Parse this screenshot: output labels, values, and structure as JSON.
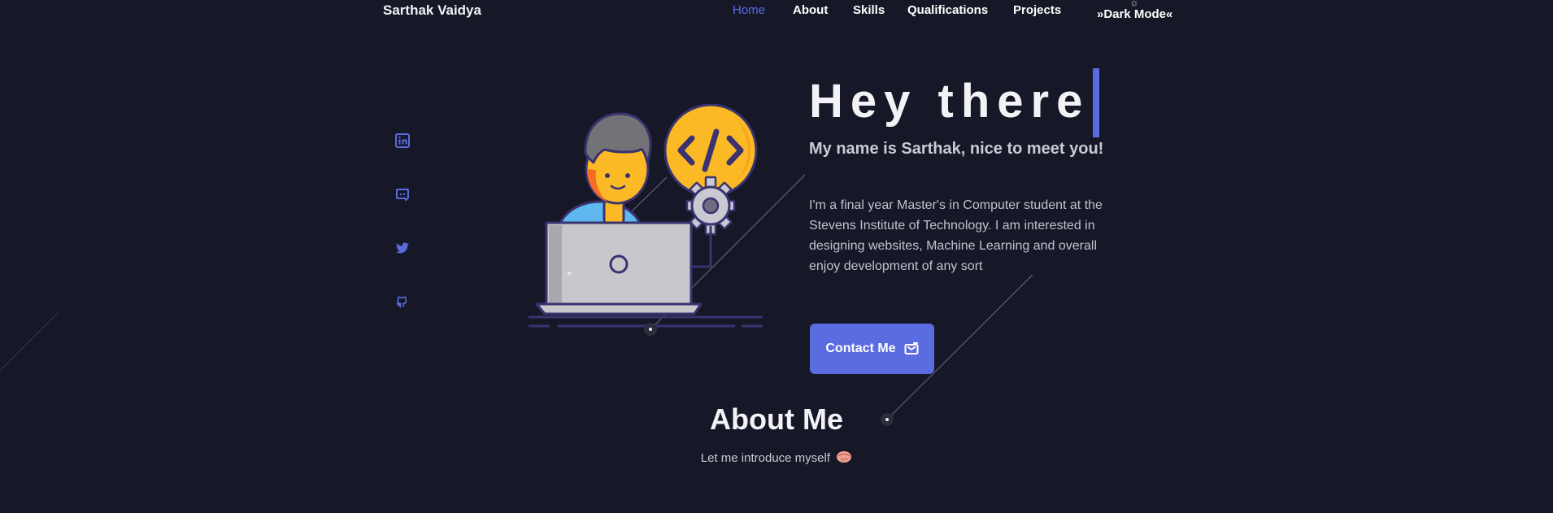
{
  "nav": {
    "brand": "Sarthak Vaidya",
    "links": [
      {
        "label": "Home",
        "active": true
      },
      {
        "label": "About"
      },
      {
        "label": "Skills"
      },
      {
        "label": "Qualifications"
      },
      {
        "label": "Projects"
      }
    ],
    "theme_toggle": "»Dark Mode«"
  },
  "social": [
    {
      "icon": "linkedin-icon"
    },
    {
      "icon": "discord-icon"
    },
    {
      "icon": "twitter-icon"
    },
    {
      "icon": "github-icon"
    }
  ],
  "hero": {
    "greeting": "Hey there",
    "subtitle": "My name is Sarthak, nice to meet you!",
    "description": "I'm a final year Master's in Computer student at the Stevens Institute of Technology. I am interested in designing websites, Machine Learning and overall enjoy development of any sort",
    "contact_label": "Contact Me"
  },
  "about": {
    "title": "About Me",
    "subtitle": "Let me introduce myself"
  },
  "colors": {
    "background": "#161827",
    "accent": "#5b6be0",
    "text": "#f3f3f7"
  }
}
